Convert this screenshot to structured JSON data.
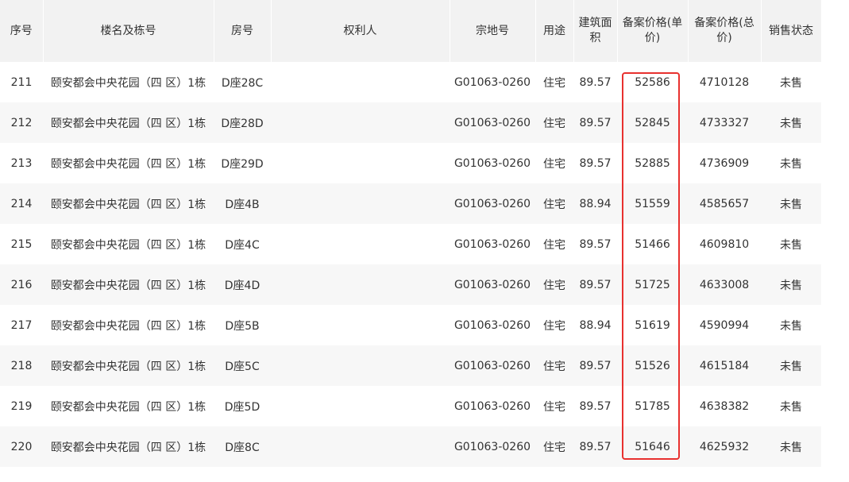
{
  "table": {
    "headers": [
      "序号",
      "楼名及栋号",
      "房号",
      "权利人",
      "宗地号",
      "用途",
      "建筑面积",
      "备案价格(单价)",
      "备案价格(总价)",
      "销售状态"
    ],
    "rows": [
      [
        "211",
        "颐安都会中央花园（四 区）1栋",
        "D座28C",
        "",
        "G01063-0260",
        "住宅",
        "89.57",
        "52586",
        "4710128",
        "未售"
      ],
      [
        "212",
        "颐安都会中央花园（四 区）1栋",
        "D座28D",
        "",
        "G01063-0260",
        "住宅",
        "89.57",
        "52845",
        "4733327",
        "未售"
      ],
      [
        "213",
        "颐安都会中央花园（四 区）1栋",
        "D座29D",
        "",
        "G01063-0260",
        "住宅",
        "89.57",
        "52885",
        "4736909",
        "未售"
      ],
      [
        "214",
        "颐安都会中央花园（四 区）1栋",
        "D座4B",
        "",
        "G01063-0260",
        "住宅",
        "88.94",
        "51559",
        "4585657",
        "未售"
      ],
      [
        "215",
        "颐安都会中央花园（四 区）1栋",
        "D座4C",
        "",
        "G01063-0260",
        "住宅",
        "89.57",
        "51466",
        "4609810",
        "未售"
      ],
      [
        "216",
        "颐安都会中央花园（四 区）1栋",
        "D座4D",
        "",
        "G01063-0260",
        "住宅",
        "89.57",
        "51725",
        "4633008",
        "未售"
      ],
      [
        "217",
        "颐安都会中央花园（四 区）1栋",
        "D座5B",
        "",
        "G01063-0260",
        "住宅",
        "88.94",
        "51619",
        "4590994",
        "未售"
      ],
      [
        "218",
        "颐安都会中央花园（四 区）1栋",
        "D座5C",
        "",
        "G01063-0260",
        "住宅",
        "89.57",
        "51526",
        "4615184",
        "未售"
      ],
      [
        "219",
        "颐安都会中央花园（四 区）1栋",
        "D座5D",
        "",
        "G01063-0260",
        "住宅",
        "89.57",
        "51785",
        "4638382",
        "未售"
      ],
      [
        "220",
        "颐安都会中央花园（四 区）1栋",
        "D座8C",
        "",
        "G01063-0260",
        "住宅",
        "89.57",
        "51646",
        "4625932",
        "未售"
      ]
    ]
  },
  "colors": {
    "header_bg": "#f2f2f2",
    "row_alt_bg": "#f7f7f7",
    "highlight_border": "#e8312f",
    "text": "#333333"
  }
}
